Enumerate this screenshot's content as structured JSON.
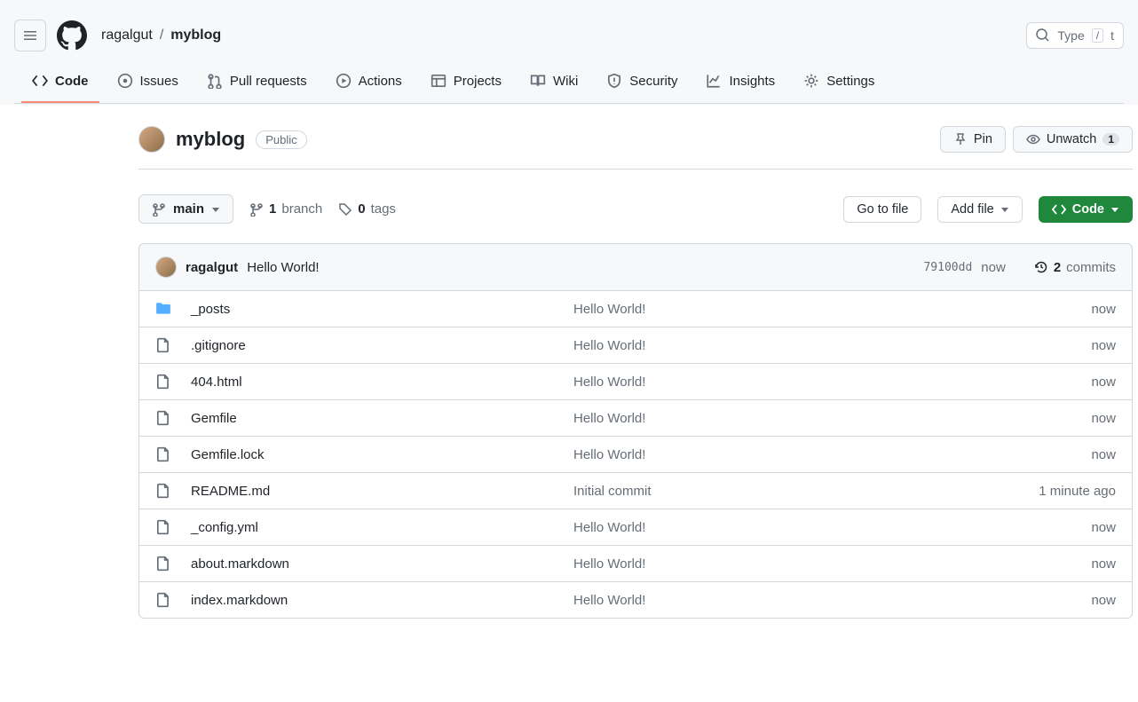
{
  "header": {
    "owner": "ragalgut",
    "sep": "/",
    "repo": "myblog",
    "search_placeholder": "Type",
    "search_key": "/",
    "search_tail": "t"
  },
  "tabs": [
    {
      "label": "Code",
      "active": true
    },
    {
      "label": "Issues"
    },
    {
      "label": "Pull requests"
    },
    {
      "label": "Actions"
    },
    {
      "label": "Projects"
    },
    {
      "label": "Wiki"
    },
    {
      "label": "Security"
    },
    {
      "label": "Insights"
    },
    {
      "label": "Settings"
    }
  ],
  "repo": {
    "name": "myblog",
    "visibility": "Public",
    "pin_label": "Pin",
    "watch_label": "Unwatch",
    "watch_count": "1"
  },
  "toolbar": {
    "branch": "main",
    "branch_count": "1",
    "branch_word": "branch",
    "tag_count": "0",
    "tag_word": "tags",
    "goto_file": "Go to file",
    "add_file": "Add file",
    "code_btn": "Code"
  },
  "last_commit": {
    "author": "ragalgut",
    "message": "Hello World!",
    "sha": "79100dd",
    "time": "now",
    "commit_count": "2",
    "commit_word": "commits"
  },
  "files": [
    {
      "type": "folder",
      "name": "_posts",
      "msg": "Hello World!",
      "age": "now"
    },
    {
      "type": "file",
      "name": ".gitignore",
      "msg": "Hello World!",
      "age": "now"
    },
    {
      "type": "file",
      "name": "404.html",
      "msg": "Hello World!",
      "age": "now"
    },
    {
      "type": "file",
      "name": "Gemfile",
      "msg": "Hello World!",
      "age": "now"
    },
    {
      "type": "file",
      "name": "Gemfile.lock",
      "msg": "Hello World!",
      "age": "now"
    },
    {
      "type": "file",
      "name": "README.md",
      "msg": "Initial commit",
      "age": "1 minute ago"
    },
    {
      "type": "file",
      "name": "_config.yml",
      "msg": "Hello World!",
      "age": "now"
    },
    {
      "type": "file",
      "name": "about.markdown",
      "msg": "Hello World!",
      "age": "now"
    },
    {
      "type": "file",
      "name": "index.markdown",
      "msg": "Hello World!",
      "age": "now"
    }
  ]
}
